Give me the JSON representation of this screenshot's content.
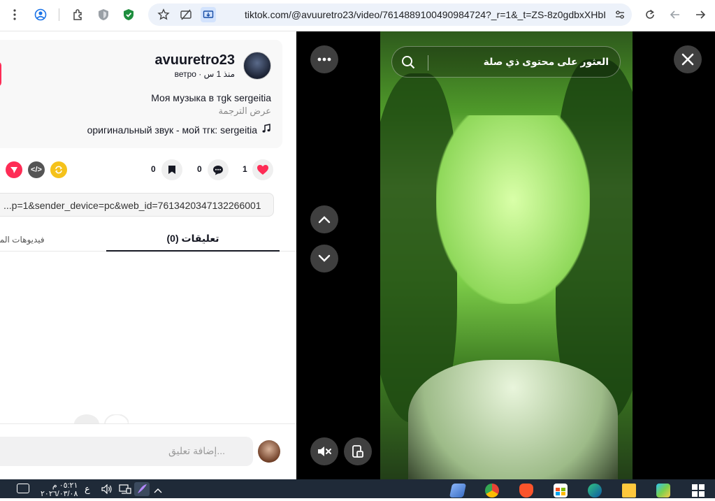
{
  "browser": {
    "url": "tiktok.com/@avuuretro23/video/7614889100490984724?_r=1&_t=ZS-8z0gdbxXHbI"
  },
  "post": {
    "username": "avuuretro23",
    "subline": "ветро · منذ 1 س",
    "description": "Моя музыка в тgk sergeitia",
    "see_translation": "عرض الترجمة",
    "music": "оригинальный звук - мой тгк: sergeitia",
    "like_count": "1",
    "comment_count": "0",
    "bookmark_count": "0",
    "link": "...p=1&sender_device=pc&web_id=7613420347132266001"
  },
  "tabs": {
    "comments": "تعليقات (0)",
    "creator_videos": "فيديوهات المبد"
  },
  "comment_box": {
    "placeholder": "إضافة تعليق..."
  },
  "player": {
    "search_placeholder": "العثور على محتوى ذي صلة"
  },
  "taskbar": {
    "time": "٠٥:٢١ م",
    "date": "٢٠٢٦/٠٣/٠٨",
    "lang": "ع"
  },
  "colors": {
    "accent": "#fe2c55",
    "like": "#fe2c55",
    "player_bg": "#000000",
    "taskbar_bg": "#1f2a38"
  }
}
